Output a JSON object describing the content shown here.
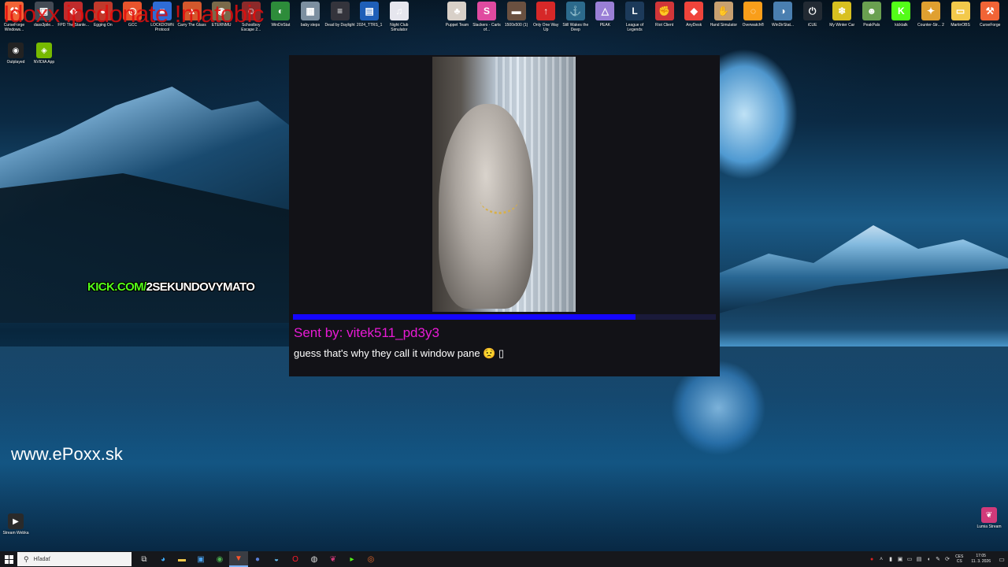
{
  "overlay": {
    "stream_title": "Idoxx ipcdonate !matobic",
    "kick_prefix": "KICK.COM/",
    "kick_channel": "2SEKUNDOVYMATO",
    "website": "www.ePoxx.sk"
  },
  "alert": {
    "sender": "Sent by: vitek511_pd3y3",
    "message": "guess that's why they call it window pane 😟 ▯",
    "progress_fraction": 0.81,
    "progress_color": "#1405ff",
    "sender_color": "#e91ad6"
  },
  "desktop_icons": [
    {
      "label": "CurseForge Windows...",
      "icon": "curseforge-icon",
      "color": "#f16436",
      "glyph": "⚒"
    },
    {
      "label": "dass3pile...",
      "icon": "app-icon",
      "color": "#444b55",
      "glyph": "▣"
    },
    {
      "label": "FPD The Stanle...",
      "icon": "game-icon",
      "color": "#c02c2c",
      "glyph": "◆"
    },
    {
      "label": "Egging On",
      "icon": "game-icon",
      "color": "#c0392b",
      "glyph": "●"
    },
    {
      "label": "GCC",
      "icon": "gcc-icon",
      "color": "#e8542c",
      "glyph": "◎"
    },
    {
      "label": "LOCKDOWN Protocol",
      "icon": "game-icon",
      "color": "#2e6cd6",
      "glyph": "■"
    },
    {
      "label": "Carry The Glass",
      "icon": "game-icon",
      "color": "#d3582c",
      "glyph": "▲"
    },
    {
      "label": "ETERNMU",
      "icon": "game-icon",
      "color": "#7a6a4a",
      "glyph": "◉"
    },
    {
      "label": "Schoolboy Escape 2...",
      "icon": "game-icon",
      "color": "#8c2a2a",
      "glyph": "☺"
    },
    {
      "label": "WinDirStat",
      "icon": "windirstat-icon",
      "color": "#2d8c3a",
      "glyph": "◐"
    },
    {
      "label": "baby steps",
      "icon": "game-icon",
      "color": "#7c8fa0",
      "glyph": "▦"
    },
    {
      "label": "Dead by Daylight",
      "icon": "game-icon",
      "color": "#34343c",
      "glyph": "≡"
    },
    {
      "label": "2024_TTRS_1",
      "icon": "image-icon",
      "color": "#1f5fb8",
      "glyph": "▤"
    },
    {
      "label": "Night Club Simulator",
      "icon": "game-icon",
      "color": "#e6e6ee",
      "glyph": "♫"
    },
    {
      "label": "Puppet Team",
      "icon": "game-icon",
      "color": "#d8d0c8",
      "glyph": "♣"
    },
    {
      "label": "Slackers - Carts of...",
      "icon": "game-icon",
      "color": "#e04aa0",
      "glyph": "S"
    },
    {
      "label": "1500x500 (1)",
      "icon": "image-icon",
      "color": "#6a5040",
      "glyph": "▬"
    },
    {
      "label": "Only One Way Up",
      "icon": "game-icon",
      "color": "#d62828",
      "glyph": "↑"
    },
    {
      "label": "Still Wakes the Deep",
      "icon": "game-icon",
      "color": "#2c6a8c",
      "glyph": "⚓"
    },
    {
      "label": "PEAK",
      "icon": "game-icon",
      "color": "#9a7fd6",
      "glyph": "△"
    },
    {
      "label": "League of Legends",
      "icon": "league-icon",
      "color": "#1c3a5a",
      "glyph": "L"
    },
    {
      "label": "Riot Client",
      "icon": "riot-icon",
      "color": "#d13639",
      "glyph": "✊"
    },
    {
      "label": "AnyDesk",
      "icon": "anydesk-icon",
      "color": "#ef443b",
      "glyph": "◆"
    },
    {
      "label": "Hand Simulator",
      "icon": "game-icon",
      "color": "#c8a070",
      "glyph": "✋"
    },
    {
      "label": "Overwatch®",
      "icon": "overwatch-icon",
      "color": "#f99e1a",
      "glyph": "◌"
    },
    {
      "label": "WinDirStat...",
      "icon": "windirstat-icon",
      "color": "#4a7fb0",
      "glyph": "◑"
    },
    {
      "label": "iCUE",
      "icon": "icue-icon",
      "color": "#222a33",
      "glyph": "⏻"
    },
    {
      "label": "My Winter Car",
      "icon": "game-icon",
      "color": "#d8c020",
      "glyph": "❄"
    },
    {
      "label": "PeakPals",
      "icon": "game-icon",
      "color": "#6aa050",
      "glyph": "☻"
    },
    {
      "label": "kicktalk",
      "icon": "kick-icon",
      "color": "#53fc18",
      "glyph": "K"
    },
    {
      "label": "Counter-Str... 2",
      "icon": "cs2-icon",
      "color": "#e0a030",
      "glyph": "✦"
    },
    {
      "label": "MartinOBS",
      "icon": "folder-icon",
      "color": "#f3c94b",
      "glyph": "▭"
    },
    {
      "label": "CurseForge",
      "icon": "curseforge-icon",
      "color": "#f16436",
      "glyph": "⚒"
    }
  ],
  "side_icons": [
    {
      "label": "Outplayed",
      "icon": "outplayed-icon",
      "color": "#222",
      "glyph": "◉"
    },
    {
      "label": "NVIDIA App",
      "icon": "nvidia-icon",
      "color": "#76b900",
      "glyph": "◈"
    },
    {
      "label": "Stream Webka",
      "icon": "shortcut-icon",
      "color": "#2a2a2a",
      "glyph": "▶"
    },
    {
      "label": "Lumia Stream",
      "icon": "lumia-icon",
      "color": "#d13a7a",
      "glyph": "❦"
    }
  ],
  "taskbar": {
    "search_placeholder": "Hľadať",
    "apps": [
      {
        "icon": "task-view-icon",
        "glyph": "⧉",
        "color": "#ddd"
      },
      {
        "icon": "edge-icon",
        "glyph": "◕",
        "color": "#3fa9f5"
      },
      {
        "icon": "file-explorer-icon",
        "glyph": "▬",
        "color": "#f3c94b"
      },
      {
        "icon": "store-icon",
        "glyph": "▣",
        "color": "#4aa3f0"
      },
      {
        "icon": "chrome-icon",
        "glyph": "◉",
        "color": "#4caf50"
      },
      {
        "icon": "brave-icon",
        "glyph": "▼",
        "color": "#fb542b",
        "active": true
      },
      {
        "icon": "app-icon",
        "glyph": "●",
        "color": "#5a7ed6"
      },
      {
        "icon": "steam-icon",
        "glyph": "◒",
        "color": "#66c0f4"
      },
      {
        "icon": "opera-icon",
        "glyph": "O",
        "color": "#ff1b2d"
      },
      {
        "icon": "obs-icon",
        "glyph": "◍",
        "color": "#ddd"
      },
      {
        "icon": "lumia-icon",
        "glyph": "❦",
        "color": "#d13a7a"
      },
      {
        "icon": "terminal-icon",
        "glyph": "▸",
        "color": "#53fc18"
      },
      {
        "icon": "app-icon",
        "glyph": "◎",
        "color": "#e86a2c"
      }
    ],
    "tray_lang": "CES",
    "tray_lang2": "CS",
    "time": "17:05",
    "date": "11. 3. 2026"
  }
}
